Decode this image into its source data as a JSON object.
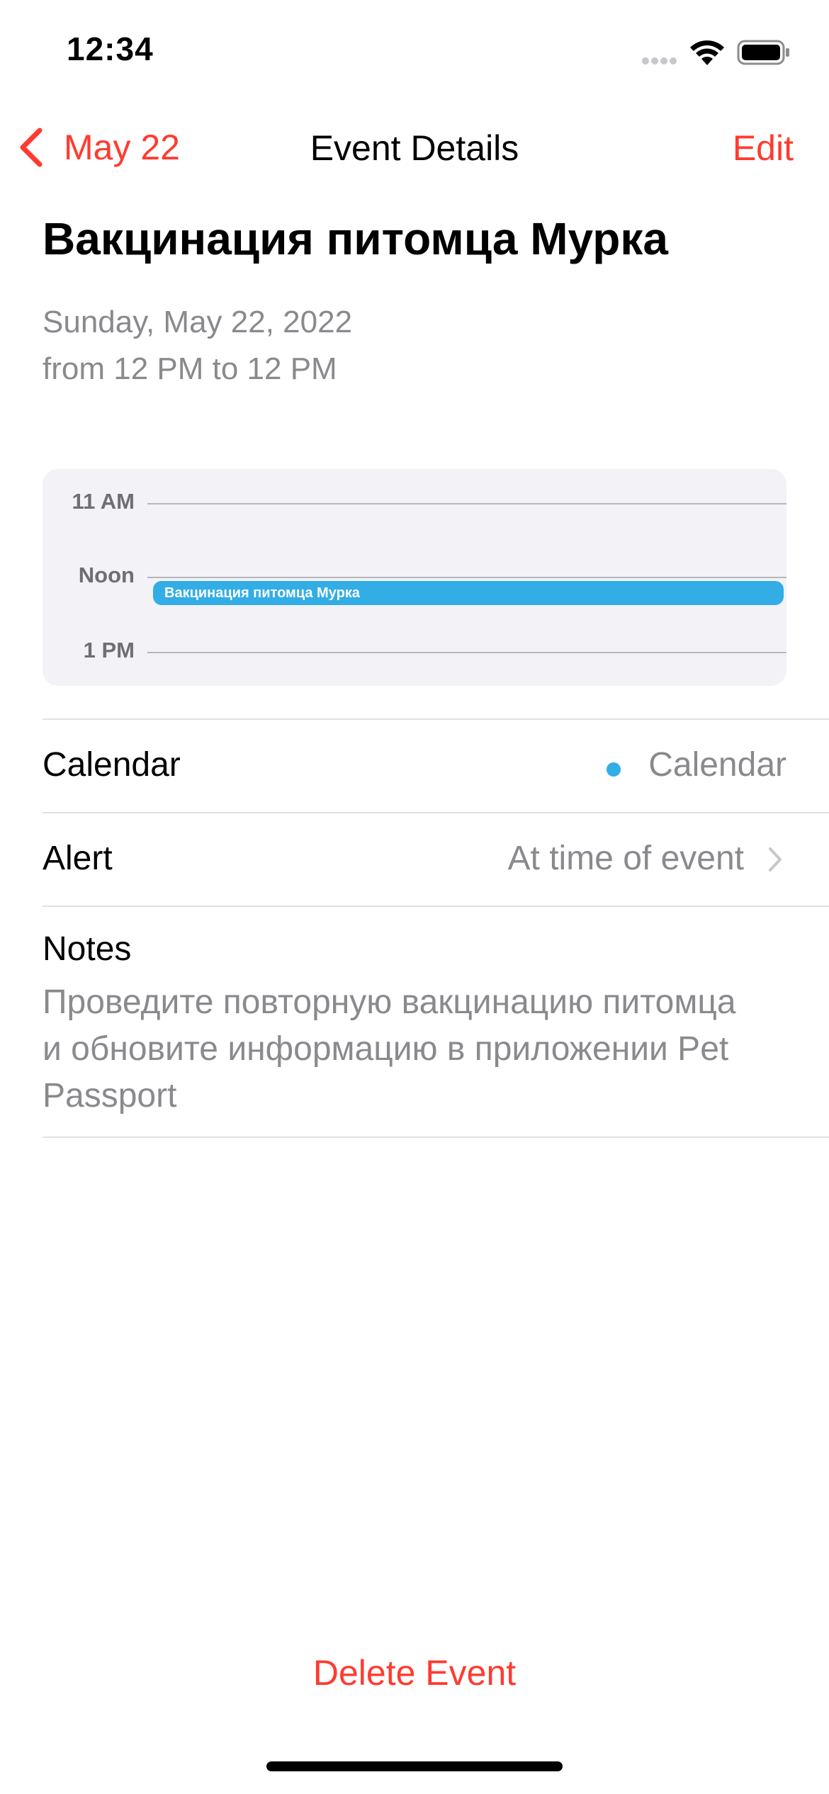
{
  "status_bar": {
    "time": "12:34",
    "icons": [
      "signal-icon",
      "wifi-icon",
      "battery-icon"
    ]
  },
  "nav": {
    "back_label": "May 22",
    "title": "Event Details",
    "edit_label": "Edit",
    "accent_color": "#ff3b30"
  },
  "event": {
    "title": "Вакцинация питомца Мурка",
    "date": "Sunday, May 22, 2022",
    "time_range": "from 12 PM to 12 PM"
  },
  "timeline": {
    "labels": [
      "11 AM",
      "Noon",
      "1 PM"
    ],
    "event_label": "Вакцинация питомца Мурка",
    "event_color": "#32ade6"
  },
  "details": {
    "calendar_label": "Calendar",
    "calendar_value": "Calendar",
    "calendar_color": "#32ade6",
    "alert_label": "Alert",
    "alert_value": "At time of event",
    "notes_label": "Notes",
    "notes_text": "Проведите повторную вакцинацию питомца и обновите информацию в приложении Pet Passport"
  },
  "actions": {
    "delete_label": "Delete Event"
  }
}
